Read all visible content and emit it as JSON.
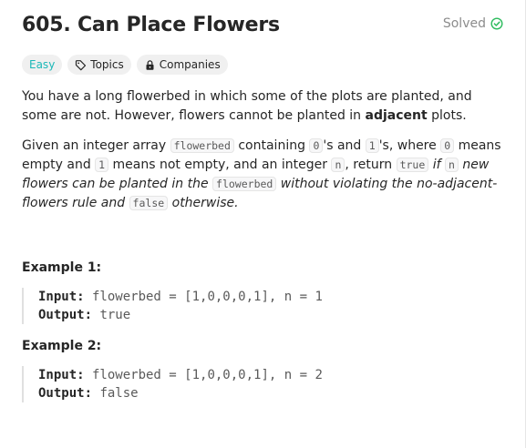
{
  "problem": {
    "title": "605. Can Place Flowers",
    "solved_label": "Solved",
    "tags": {
      "difficulty": "Easy",
      "topics": "Topics",
      "companies": "Companies"
    }
  },
  "description": {
    "p1": {
      "a": "You have a long flowerbed in which some of the plots are planted, and some are not. However, flowers cannot be planted in ",
      "b": "adjacent",
      "c": " plots."
    },
    "p2": {
      "a": "Given an integer array ",
      "code1": "flowerbed",
      "b": " containing ",
      "code2": "0",
      "c": "'s and ",
      "code3": "1",
      "d": "'s, where ",
      "code4": "0",
      "e": " means empty and ",
      "code5": "1",
      "f": " means not empty, and an integer ",
      "code6": "n",
      "g": ", return ",
      "code7": "true",
      "h": " if ",
      "code8": "n",
      "i": " new flowers can be planted in the ",
      "code9": "flowerbed",
      "j": " without violating the no-adjacent-flowers rule and ",
      "code10": "false",
      "k": " otherwise."
    }
  },
  "examples": [
    {
      "title": "Example 1:",
      "input_label": "Input:",
      "input_value": " flowerbed = [1,0,0,0,1], n = 1",
      "output_label": "Output:",
      "output_value": " true"
    },
    {
      "title": "Example 2:",
      "input_label": "Input:",
      "input_value": " flowerbed = [1,0,0,0,1], n = 2",
      "output_label": "Output:",
      "output_value": " false"
    }
  ],
  "colors": {
    "easy": "#1cb8b8",
    "solved_check": "#2cbb5d"
  },
  "icons": {
    "solved": "check-circle-icon",
    "topics": "tag-icon",
    "companies": "lock-icon"
  }
}
